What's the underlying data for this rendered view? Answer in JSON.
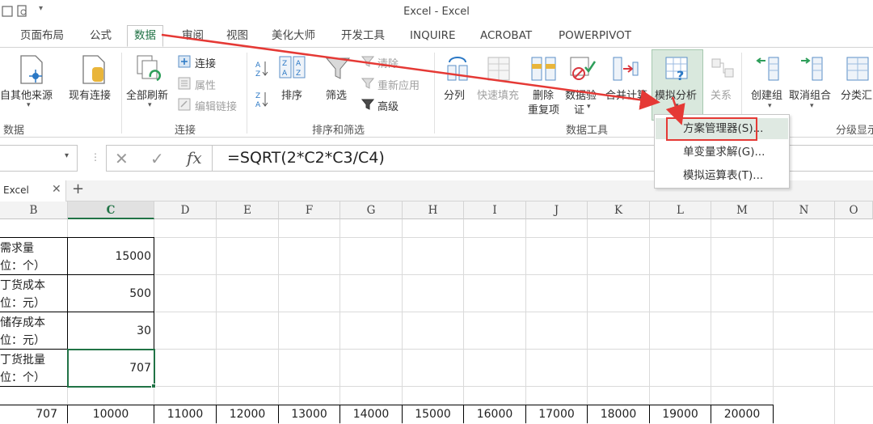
{
  "window": {
    "title": "Excel - Excel"
  },
  "tabs": [
    "页面布局",
    "公式",
    "数据",
    "审阅",
    "视图",
    "美化大师",
    "开发工具",
    "INQUIRE",
    "ACROBAT",
    "POWERPIVOT"
  ],
  "ribbon": {
    "get_external": {
      "label": "自其他来源",
      "group": "数据"
    },
    "existing_conn": {
      "label": "现有连接"
    },
    "refresh_all": {
      "label": "全部刷新"
    },
    "connections": {
      "label": "连接",
      "properties": "属性",
      "edit_links": "编辑链接",
      "group": "连接"
    },
    "sort": {
      "label": "排序"
    },
    "filter": {
      "label": "筛选",
      "clear": "清除",
      "reapply": "重新应用",
      "advanced": "高级",
      "group": "排序和筛选"
    },
    "split": {
      "label": "分列"
    },
    "flash_fill": {
      "label": "快速填充"
    },
    "remove_dup": {
      "label1": "删除",
      "label2": "重复项"
    },
    "validation": {
      "label1": "数据验",
      "label2": "证"
    },
    "consolidate": {
      "label": "合并计算"
    },
    "whatif": {
      "label": "模拟分析"
    },
    "relations": {
      "label": "关系"
    },
    "data_tools_group": "数据工具",
    "group_btn": {
      "label": "创建组"
    },
    "ungroup_btn": {
      "label": "取消组合"
    },
    "subtotal": {
      "label": "分类汇"
    },
    "outline_group": "分级显示"
  },
  "whatif_menu": [
    "方案管理器(S)...",
    "单变量求解(G)...",
    "模拟运算表(T)..."
  ],
  "formula_bar": {
    "fx": "fx",
    "formula": "=SQRT(2*C2*C3/C4)"
  },
  "sheet": {
    "workbook_tab": "Excel",
    "add": "+"
  },
  "columns": [
    "B",
    "C",
    "D",
    "E",
    "F",
    "G",
    "H",
    "I",
    "J",
    "K",
    "L",
    "M",
    "N",
    "O"
  ],
  "rows": [
    {
      "label1": "需求量",
      "label2": "位：个）",
      "value": "15000"
    },
    {
      "label1": "丁货成本",
      "label2": "位：元）",
      "value": "500"
    },
    {
      "label1": "储存成本",
      "label2": "位：元）",
      "value": "30"
    },
    {
      "label1": "丁货批量",
      "label2": "位：个）",
      "value": "707"
    }
  ],
  "data_table_row": [
    "707",
    "10000",
    "11000",
    "12000",
    "13000",
    "14000",
    "15000",
    "16000",
    "17000",
    "18000",
    "19000",
    "20000"
  ],
  "colors": {
    "accent": "#217346",
    "highlight": "#e53935",
    "menu_hover": "#dfe9e2"
  }
}
